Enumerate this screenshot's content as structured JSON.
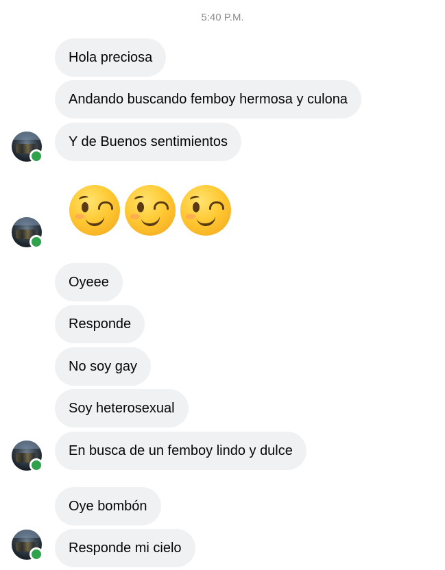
{
  "timestamp": "5:40 P.M.",
  "contact": {
    "avatar_icon": "user-avatar",
    "online_status_icon": "online-dot",
    "online_color": "#31a24c"
  },
  "colors": {
    "bubble_background": "#f0f1f3",
    "bubble_text": "#050505",
    "timestamp_text": "#8a8d91"
  },
  "messages": {
    "group1": [
      "Hola preciosa",
      "Andando buscando femboy hermosa y culona",
      "Y de Buenos sentimientos"
    ],
    "group2_emojis": [
      "😉",
      "😉",
      "😉"
    ],
    "group3": [
      "Oyeee",
      "Responde",
      "No soy gay",
      "Soy heterosexual",
      "En busca de un femboy lindo y dulce"
    ],
    "group4": [
      "Oye bombón",
      "Responde mi cielo"
    ]
  }
}
